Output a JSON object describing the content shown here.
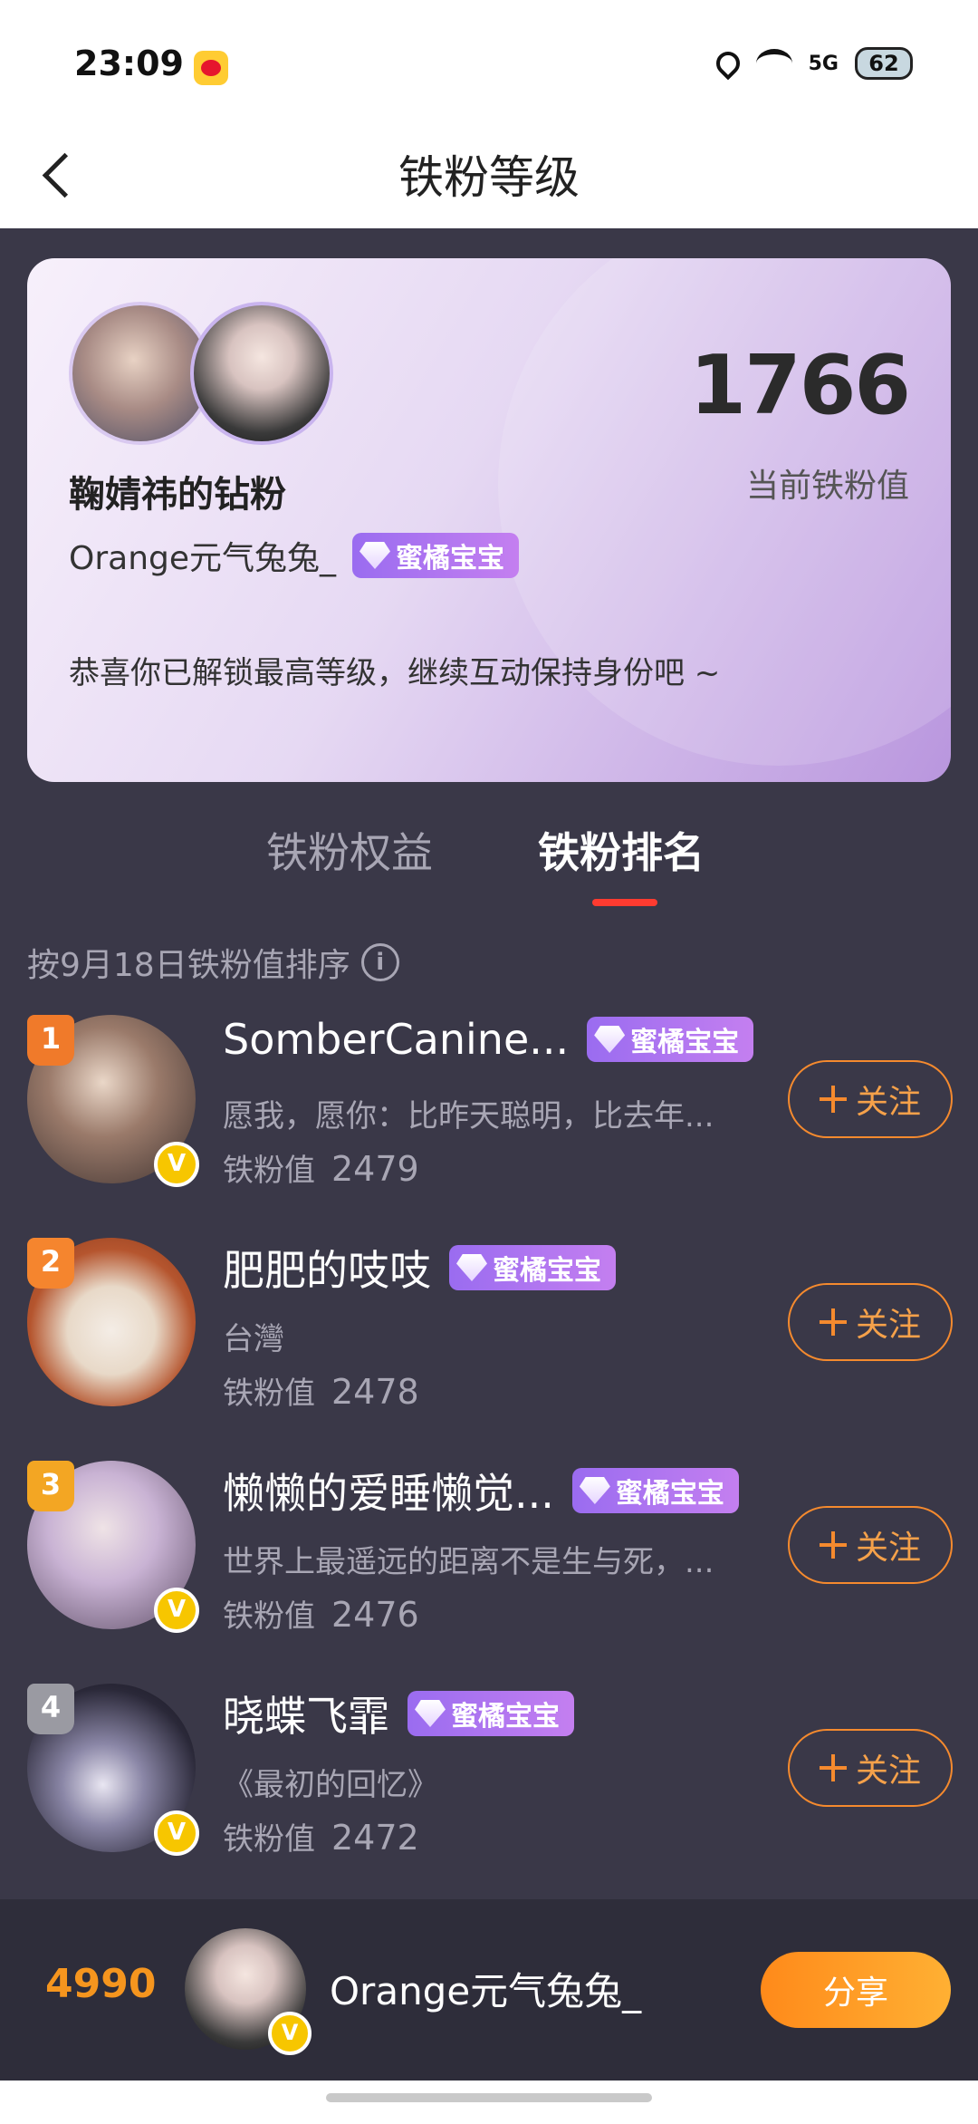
{
  "status_bar": {
    "time": "23:09",
    "network": "5G",
    "battery": "62"
  },
  "nav": {
    "title": "铁粉等级"
  },
  "card": {
    "fan_title": "鞠婧祎的钻粉",
    "username": "Orange元气兔兔_",
    "badge_label": "蜜橘宝宝",
    "score": "1766",
    "score_label": "当前铁粉值",
    "message": "恭喜你已解锁最高等级，继续互动保持身份吧 ~"
  },
  "tabs": [
    {
      "label": "铁粉权益",
      "active": false
    },
    {
      "label": "铁粉排名",
      "active": true
    }
  ],
  "sort": {
    "text": "按9月18日铁粉值排序",
    "info_glyph": "i"
  },
  "ranking": [
    {
      "rank": "1",
      "name": "SomberCanine...",
      "badge": "蜜橘宝宝",
      "bio": "愿我，愿你：比昨天聪明，比去年...",
      "score_label": "铁粉值",
      "score": "2479",
      "follow_label": "关注",
      "verified": true,
      "medal_color": "#f07a2a"
    },
    {
      "rank": "2",
      "name": "肥肥的吱吱",
      "badge": "蜜橘宝宝",
      "bio": "台灣",
      "score_label": "铁粉值",
      "score": "2478",
      "follow_label": "关注",
      "verified": false,
      "medal_color": "#f5852e"
    },
    {
      "rank": "3",
      "name": "懒懒的爱睡懒觉...",
      "badge": "蜜橘宝宝",
      "bio": "世界上最遥远的距离不是生与死，...",
      "score_label": "铁粉值",
      "score": "2476",
      "follow_label": "关注",
      "verified": true,
      "medal_color": "#f3a623"
    },
    {
      "rank": "4",
      "name": "晓蝶飞霏",
      "badge": "蜜橘宝宝",
      "bio": "《最初的回忆》",
      "score_label": "铁粉值",
      "score": "2472",
      "follow_label": "关注",
      "verified": true,
      "medal_color": "#9a9aa2"
    }
  ],
  "bottom": {
    "my_rank_score": "4990",
    "my_name": "Orange元气兔兔_",
    "share_label": "分享",
    "verified_glyph": "V"
  },
  "colors": {
    "accent_orange": "#f5951e",
    "tab_indicator": "#ff3b30",
    "badge_purple": "#9a6cf0",
    "background": "#3a3848"
  }
}
